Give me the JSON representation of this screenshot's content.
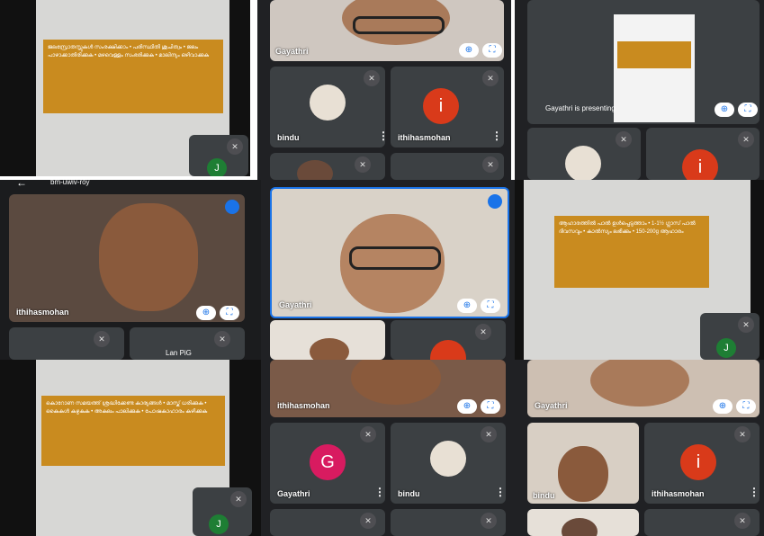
{
  "tiles": {
    "topcenter_name": "Gayathri",
    "bindu": "bindu",
    "ithihasmohan": "ithihasmohan",
    "presenting": "Gayathri is presenting",
    "avatar_letter_i": "i",
    "avatar_letter_g": "G",
    "avatar_letter_j": "J",
    "meeting_code": "bm-uwiv-roy",
    "mid_left_name": "ithihasmohan",
    "mid_center_name": "Gayathri",
    "bot_center_name": "ithihasmohan",
    "bot_right_name": "Gayathri",
    "bot_gayathri": "Gayathri",
    "bot_bindu": "bindu",
    "bot_bindu2": "bindu",
    "bot_ithihasmohan": "ithihasmohan",
    "lan_label": "Lan PiG"
  },
  "slides": {
    "top_left": "ജലസ്രോതസ്സുകൾ സംരക്ഷിക്കാം • പരിസ്ഥിതി ശുചിത്വം • ജലം പാഴാക്കാതിരിക്കുക • മഴവെള്ളം സംഭരിക്കുക • മാലിന്യം ഒഴിവാക്കുക",
    "mid_right": "ആഹാരത്തിൽ പാൽ ഉൾപ്പെടുത്താം • 1-1½ ഗ്ലാസ് പാൽ ദിവസവും • കാൽസ്യം ലഭിക്കും • 150-200g ആഹാരം",
    "bot_left": "കൊറോണ സമയത്ത് ശ്രദ്ധിക്കേണ്ട കാര്യങ്ങൾ • മാസ്ക് ധരിക്കുക • കൈകൾ കഴുകുക • അകലം പാലിക്കുക • പോഷകാഹാരം കഴിക്കുക"
  },
  "colors": {
    "tile_bg": "#3c4043",
    "panel_bg": "#202124",
    "accent": "#1a73e8",
    "avatar_red": "#d93a1a",
    "avatar_pink": "#d81b60",
    "avatar_green": "#1e7e34",
    "slide_orange": "#c98b1f"
  },
  "icons": [
    "mic-off-icon",
    "pin-icon",
    "fullscreen-icon",
    "more-vert-icon",
    "back-arrow-icon",
    "audio-wave-icon"
  ]
}
